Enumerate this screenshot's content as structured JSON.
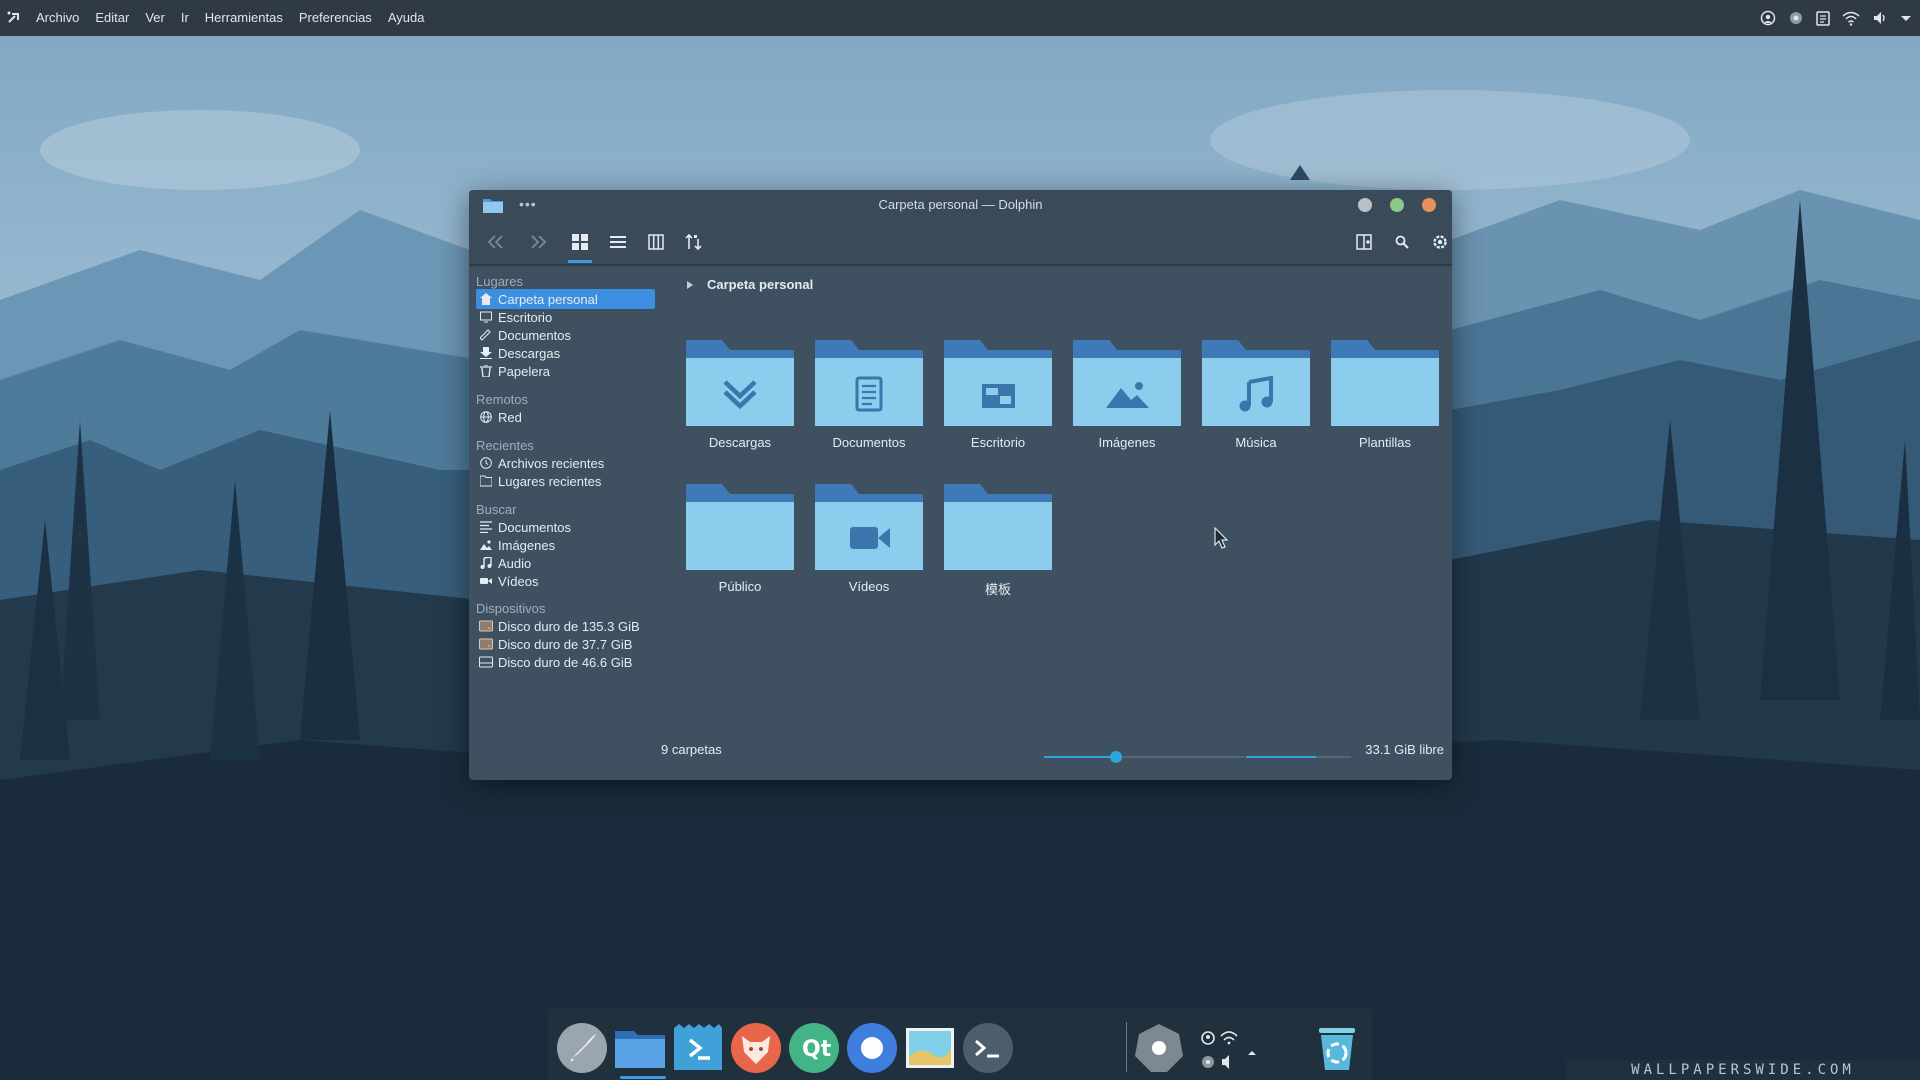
{
  "menubar": {
    "items": [
      "Archivo",
      "Editar",
      "Ver",
      "Ir",
      "Herramientas",
      "Preferencias",
      "Ayuda"
    ]
  },
  "tray": {
    "icons": [
      "network-manager-icon",
      "settings-icon",
      "clipboard-icon",
      "wifi-icon",
      "volume-icon",
      "chevron-down-icon"
    ]
  },
  "window": {
    "title": "Carpeta personal — Dolphin",
    "buttons": {
      "minimize_color": "#b9c0c7",
      "maximize_color": "#8cc887",
      "close_color": "#e8915e"
    },
    "toolbar": {
      "icons": [
        "back-icon",
        "forward-icon",
        "icons-view-icon",
        "details-view-icon",
        "columns-view-icon",
        "sort-icon",
        "split-view-icon",
        "search-icon",
        "settings-icon"
      ],
      "active_view": "icons-view-icon"
    }
  },
  "sidebar": {
    "sections": [
      {
        "title": "Lugares",
        "items": [
          {
            "label": "Carpeta personal",
            "icon": "home-icon",
            "selected": true
          },
          {
            "label": "Escritorio",
            "icon": "desktop-icon"
          },
          {
            "label": "Documentos",
            "icon": "document-icon"
          },
          {
            "label": "Descargas",
            "icon": "download-icon"
          },
          {
            "label": "Papelera",
            "icon": "trash-icon"
          }
        ]
      },
      {
        "title": "Remotos",
        "items": [
          {
            "label": "Red",
            "icon": "globe-icon"
          }
        ]
      },
      {
        "title": "Recientes",
        "items": [
          {
            "label": "Archivos recientes",
            "icon": "clock-icon"
          },
          {
            "label": "Lugares recientes",
            "icon": "folder-recent-icon"
          }
        ]
      },
      {
        "title": "Buscar",
        "items": [
          {
            "label": "Documentos",
            "icon": "text-icon"
          },
          {
            "label": "Imágenes",
            "icon": "image-icon"
          },
          {
            "label": "Audio",
            "icon": "music-icon"
          },
          {
            "label": "Vídeos",
            "icon": "video-icon"
          }
        ]
      },
      {
        "title": "Dispositivos",
        "items": [
          {
            "label": "Disco duro de 135.3 GiB",
            "icon": "harddisk-icon"
          },
          {
            "label": "Disco duro de 37.7 GiB",
            "icon": "harddisk-icon"
          },
          {
            "label": "Disco duro de 46.6 GiB",
            "icon": "harddisk-icon"
          }
        ]
      }
    ]
  },
  "breadcrumb": {
    "current": "Carpeta personal"
  },
  "folders": [
    {
      "name": "Descargas",
      "emblem": "download-icon"
    },
    {
      "name": "Documentos",
      "emblem": "document-icon"
    },
    {
      "name": "Escritorio",
      "emblem": "desktop-icon"
    },
    {
      "name": "Imágenes",
      "emblem": "image-icon"
    },
    {
      "name": "Música",
      "emblem": "music-icon"
    },
    {
      "name": "Plantillas",
      "emblem": ""
    },
    {
      "name": "Público",
      "emblem": ""
    },
    {
      "name": "Vídeos",
      "emblem": "video-icon"
    },
    {
      "name": "模板",
      "emblem": ""
    }
  ],
  "statusbar": {
    "count": "9 carpetas",
    "zoom_fraction": 0.36,
    "used_fraction": 0.67,
    "free": "33.1 GiB libre"
  },
  "dock": {
    "apps": [
      "launcher-icon",
      "file-manager-icon",
      "kdevelop-icon",
      "firefox-icon",
      "qt-creator-icon",
      "chromium-icon",
      "image-viewer-icon",
      "terminal-icon",
      "system-settings-icon",
      "trash-icon"
    ],
    "active": "file-manager-icon"
  },
  "watermark": "WALLPAPERSWIDE.COM"
}
